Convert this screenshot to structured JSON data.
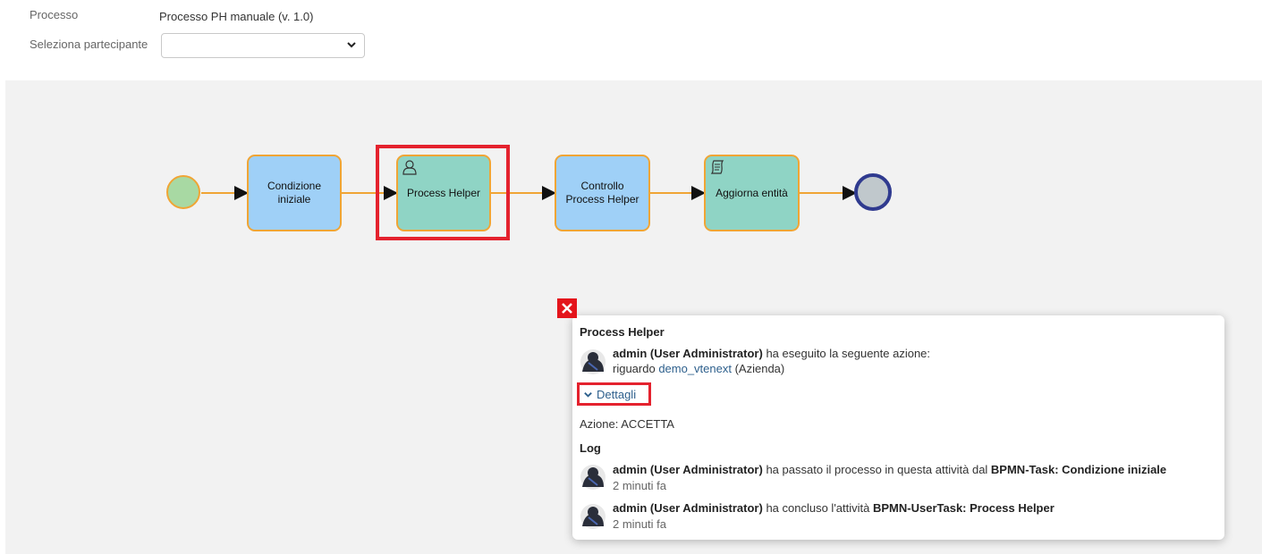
{
  "header": {
    "process_label": "Processo",
    "process_value": "Processo PH manuale (v. 1.0)",
    "participant_label": "Seleziona partecipante",
    "participant_value": ""
  },
  "diagram": {
    "tasks": [
      {
        "label_line1": "Condizione",
        "label_line2": "iniziale"
      },
      {
        "label_line1": "Process Helper",
        "label_line2": ""
      },
      {
        "label_line1": "Controllo",
        "label_line2": "Process Helper"
      },
      {
        "label_line1": "Aggiorna entità",
        "label_line2": ""
      }
    ],
    "colors": {
      "start": "#a8d9a3",
      "end": "#c0c8cc",
      "end_border": "#2f3a8f",
      "flow": "#f0a535",
      "highlight": "#e4222e"
    }
  },
  "popup": {
    "title": "Process Helper",
    "user": "admin (User Administrator)",
    "action_text": " ha eseguito la seguente azione:",
    "regarding_prefix": "riguardo ",
    "regarding_link": "demo_vtenext",
    "regarding_suffix": " (Azienda)",
    "details_label": "Dettagli",
    "action_value": "Azione: ACCETTA",
    "log_title": "Log",
    "log": [
      {
        "user": "admin (User Administrator)",
        "text": " ha passato il processo in questa attività dal ",
        "bold": "BPMN-Task: Condizione iniziale",
        "time": "2 minuti fa"
      },
      {
        "user": "admin (User Administrator)",
        "text": " ha concluso l'attività ",
        "bold": "BPMN-UserTask: Process Helper",
        "time": "2 minuti fa"
      }
    ]
  }
}
